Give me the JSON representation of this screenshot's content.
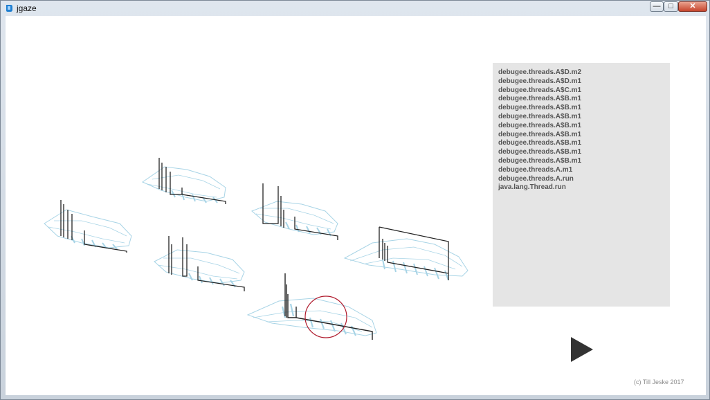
{
  "window": {
    "title": "jgaze",
    "controls": [
      "minimize-icon",
      "maximize-icon",
      "close-icon"
    ]
  },
  "stack_panel": {
    "frames": [
      "debugee.threads.A$D.m2",
      "debugee.threads.A$D.m1",
      "debugee.threads.A$C.m1",
      "debugee.threads.A$B.m1",
      "debugee.threads.A$B.m1",
      "debugee.threads.A$B.m1",
      "debugee.threads.A$B.m1",
      "debugee.threads.A$B.m1",
      "debugee.threads.A$B.m1",
      "debugee.threads.A$B.m1",
      "debugee.threads.A$B.m1",
      "debugee.threads.A.m1",
      "debugee.threads.A.run",
      "java.lang.Thread.run"
    ]
  },
  "play_button": {
    "icon": "play-icon"
  },
  "footer": {
    "copyright": "(c) Till Jeske 2017"
  },
  "colors": {
    "surface": "#a8d4e6",
    "stack_line": "#222222",
    "focus_circle": "#b01c2e",
    "panel_bg": "#e5e5e5"
  }
}
